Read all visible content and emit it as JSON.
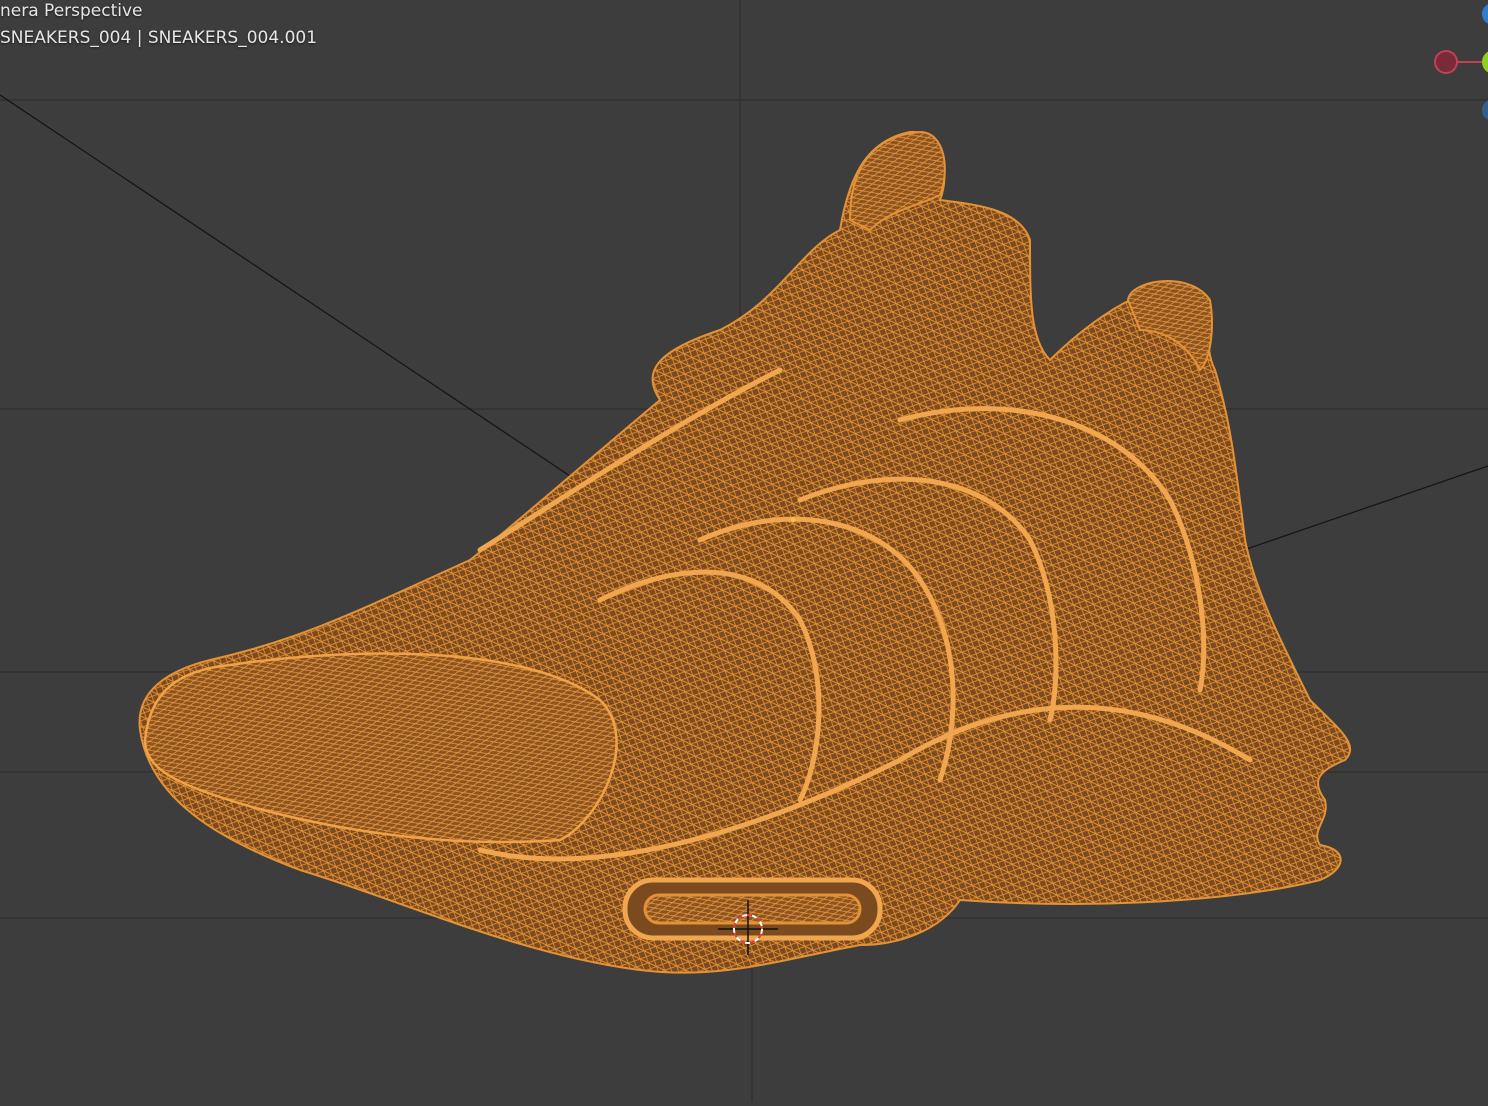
{
  "viewport": {
    "view_name": "nera Perspective",
    "object_label": "SNEAKERS_004 | SNEAKERS_004.001",
    "colors": {
      "background": "#3d3d3d",
      "grid": "#303030",
      "axis_line": "#151515",
      "mesh_wire": "#d98a32",
      "mesh_fill": "#8a5524",
      "cursor_red": "#e04040",
      "cursor_white": "#ffffff"
    }
  },
  "gizmo": {
    "axes": [
      {
        "name": "x-negative",
        "color": "#c24055"
      },
      {
        "name": "y-positive",
        "color": "#8fcf1f"
      },
      {
        "name": "z-positive",
        "color": "#2f7dd1"
      },
      {
        "name": "z-negative",
        "color": "#355e8f"
      }
    ]
  },
  "icons": {
    "cursor": "3d-cursor-icon",
    "gizmo": "navigation-gizmo-icon"
  }
}
